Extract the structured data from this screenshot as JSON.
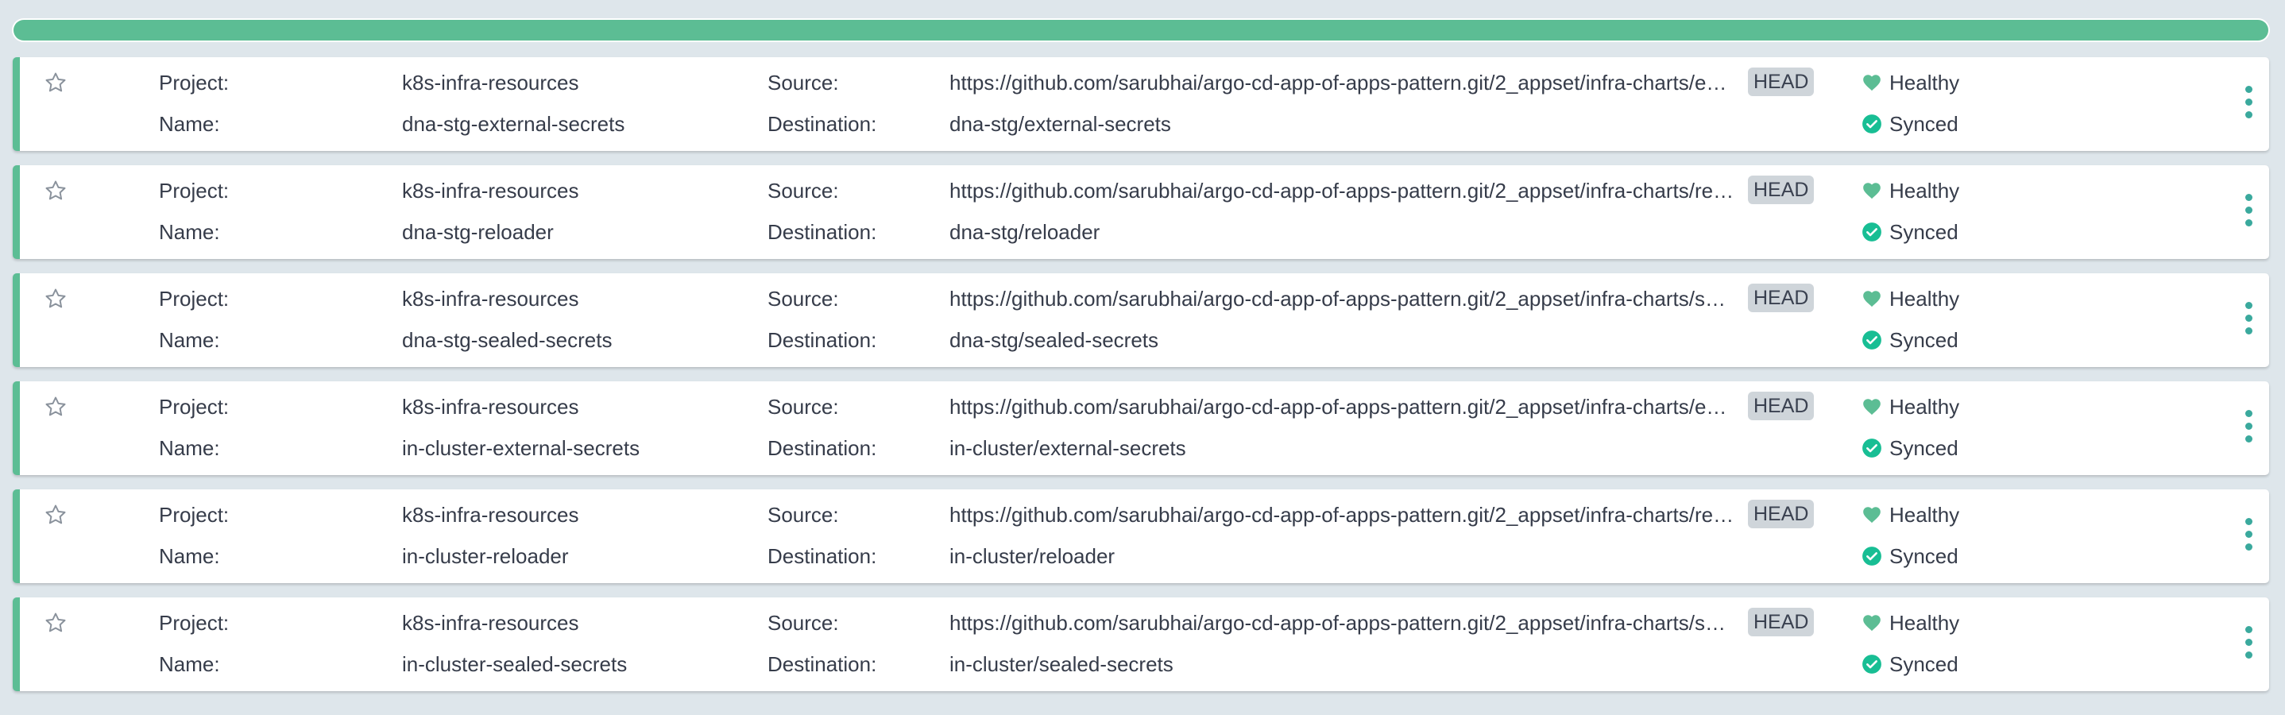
{
  "colors": {
    "healthy": "#5cbd94",
    "synced": "#18be94",
    "kebab": "#3aa99d",
    "badge_bg": "#cfd5da"
  },
  "labels": {
    "project": "Project:",
    "name": "Name:",
    "source": "Source:",
    "destination": "Destination:",
    "revision": "HEAD",
    "health": "Healthy",
    "sync": "Synced"
  },
  "icons": {
    "favorite": "star-outline-icon",
    "health": "heart-icon",
    "sync": "check-circle-icon",
    "menu": "vertical-ellipsis-icon"
  },
  "apps": [
    {
      "project": "k8s-infra-resources",
      "name": "dna-stg-external-secrets",
      "source": "https://github.com/sarubhai/argo-cd-app-of-apps-pattern.git/2_appset/infra-charts/e…",
      "destination": "dna-stg/external-secrets"
    },
    {
      "project": "k8s-infra-resources",
      "name": "dna-stg-reloader",
      "source": "https://github.com/sarubhai/argo-cd-app-of-apps-pattern.git/2_appset/infra-charts/re…",
      "destination": "dna-stg/reloader"
    },
    {
      "project": "k8s-infra-resources",
      "name": "dna-stg-sealed-secrets",
      "source": "https://github.com/sarubhai/argo-cd-app-of-apps-pattern.git/2_appset/infra-charts/s…",
      "destination": "dna-stg/sealed-secrets"
    },
    {
      "project": "k8s-infra-resources",
      "name": "in-cluster-external-secrets",
      "source": "https://github.com/sarubhai/argo-cd-app-of-apps-pattern.git/2_appset/infra-charts/e…",
      "destination": "in-cluster/external-secrets"
    },
    {
      "project": "k8s-infra-resources",
      "name": "in-cluster-reloader",
      "source": "https://github.com/sarubhai/argo-cd-app-of-apps-pattern.git/2_appset/infra-charts/re…",
      "destination": "in-cluster/reloader"
    },
    {
      "project": "k8s-infra-resources",
      "name": "in-cluster-sealed-secrets",
      "source": "https://github.com/sarubhai/argo-cd-app-of-apps-pattern.git/2_appset/infra-charts/s…",
      "destination": "in-cluster/sealed-secrets"
    }
  ]
}
